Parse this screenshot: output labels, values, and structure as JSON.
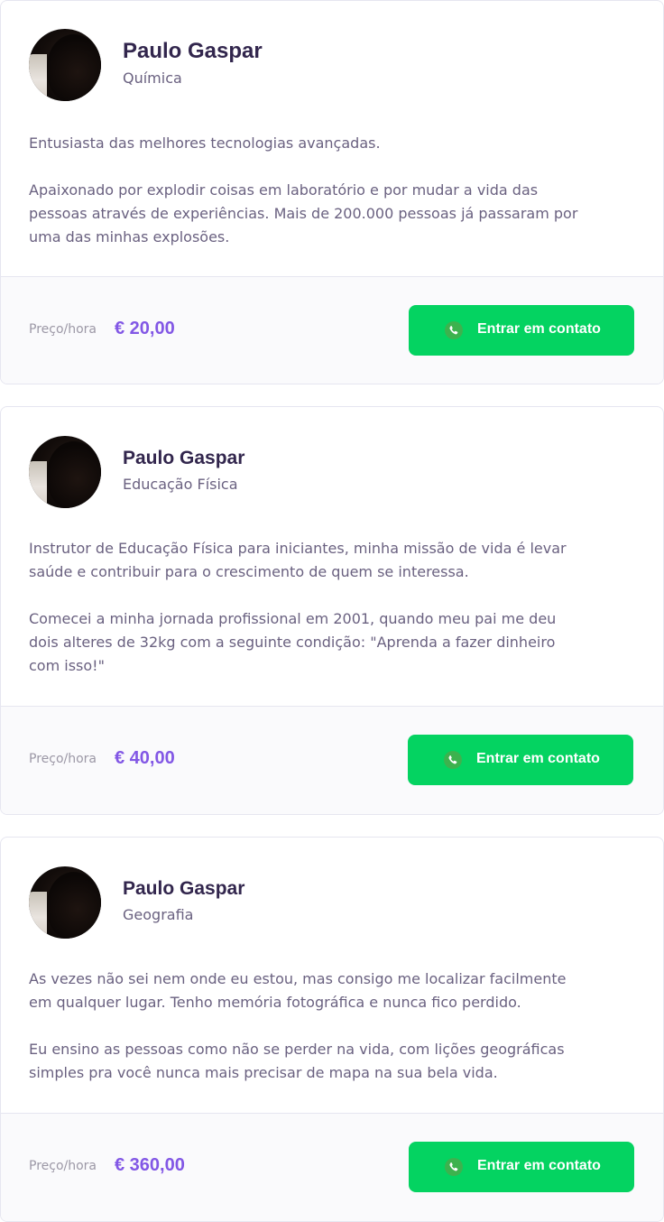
{
  "teachers": [
    {
      "name": "Paulo Gaspar",
      "subject": "Química",
      "bio": [
        "Entusiasta das melhores tecnologias  avançadas.",
        "Apaixonado por explodir coisas em laboratório e por mudar a vida das pessoas através de experiências. Mais de 200.000 pessoas já passaram por uma das minhas explosões."
      ],
      "price_label": "Preço/hora",
      "price": "€ 20,00",
      "contact_label": "Entrar em contato"
    },
    {
      "name": "Paulo Gaspar",
      "subject": "Educação Física",
      "bio": [
        "Instrutor de Educação Física para iniciantes, minha missão de vida é levar saúde e contribuir para o crescimento de quem se interessa.",
        "Comecei a minha jornada profissional em 2001, quando meu pai me deu dois alteres de 32kg com a seguinte condição: \"Aprenda a fazer dinheiro com isso!\""
      ],
      "price_label": "Preço/hora",
      "price": "€ 40,00",
      "contact_label": "Entrar em contato"
    },
    {
      "name": "Paulo Gaspar",
      "subject": "Geografia",
      "bio": [
        "As vezes não sei nem onde eu estou, mas consigo me localizar facilmente em qualquer lugar. Tenho memória fotográfica e nunca fico perdido.",
        "Eu ensino as pessoas como não se perder na vida, com lições geográficas simples pra você nunca mais precisar de mapa na sua bela vida."
      ],
      "price_label": "Preço/hora",
      "price": "€ 360,00",
      "contact_label": "Entrar em contato"
    }
  ],
  "colors": {
    "accent": "#8257e5",
    "button": "#04d361",
    "title": "#32264d",
    "text": "#6a6180"
  },
  "icons": {
    "contact": "whatsapp-icon",
    "avatar": "avatar-photo"
  }
}
